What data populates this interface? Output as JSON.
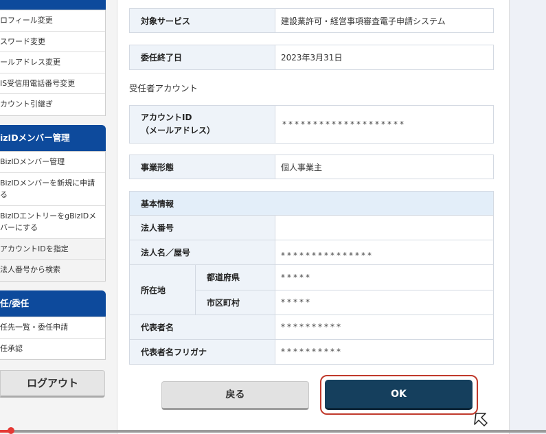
{
  "sidebar": {
    "group1": [
      "ロフィール変更",
      "スワード変更",
      "ールアドレス変更",
      "IS受信用電話番号変更",
      "カウント引継ぎ"
    ],
    "group2_header": "izIDメンバー管理",
    "group2": [
      "BizIDメンバー管理",
      "BizIDメンバーを新規に申請\nる",
      "BizIDエントリーをgBizIDメ\nバーにする",
      "アカウントIDを指定",
      "法人番号から検索"
    ],
    "group3_header": "任/委任",
    "group3": [
      "任先一覧・委任申請",
      "任承認"
    ],
    "logout_label": "ログアウト"
  },
  "form": {
    "service": {
      "label": "対象サービス",
      "value": "建設業許可・経営事項審査電子申請システム"
    },
    "end_date": {
      "label": "委任終了日",
      "value": "2023年3月31日"
    },
    "account_section_label": "受任者アカウント",
    "account_id": {
      "label": "アカウントID\n（メールアドレス）",
      "value": "********************"
    },
    "business_type": {
      "label": "事業形態",
      "value": "個人事業主"
    },
    "basic_info": {
      "header": "基本情報",
      "corp_number": {
        "label": "法人番号",
        "value": ""
      },
      "corp_name": {
        "label": "法人名／屋号",
        "value": "***************"
      },
      "address": {
        "label": "所在地",
        "prefecture": {
          "label": "都道府県",
          "value": "*****"
        },
        "city": {
          "label": "市区町村",
          "value": "*****"
        }
      },
      "representative": {
        "label": "代表者名",
        "value": "**********"
      },
      "representative_kana": {
        "label": "代表者名フリガナ",
        "value": "**********"
      }
    }
  },
  "buttons": {
    "back_label": "戻る",
    "ok_label": "OK"
  },
  "video_progress": {
    "fraction": 0.02
  },
  "colors": {
    "nav_blue": "#0d4a9c",
    "ok_button": "#153f5d",
    "highlight_ring": "#c0392b",
    "progress": "#e53935"
  }
}
